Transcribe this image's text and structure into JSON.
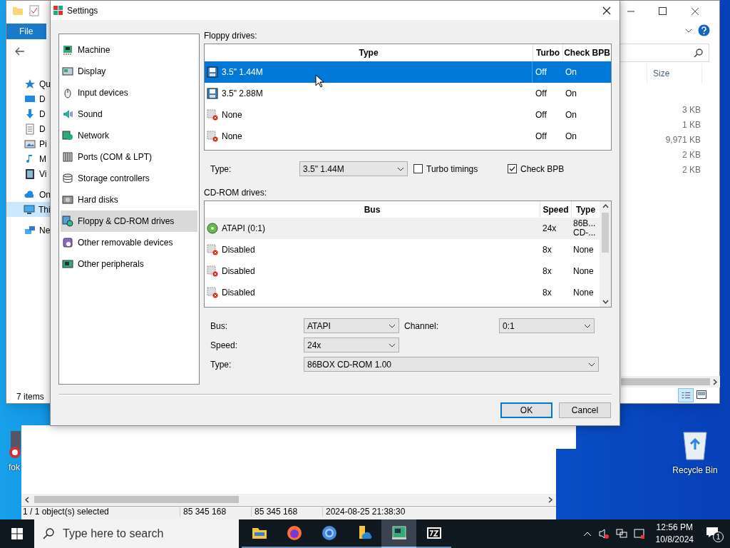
{
  "explorer": {
    "ribbon_tab": "File",
    "nav_items": [
      {
        "label": "Qu",
        "kind": "star",
        "selected": false
      },
      {
        "label": "D",
        "kind": "desktop",
        "selected": false
      },
      {
        "label": "D",
        "kind": "download",
        "selected": false
      },
      {
        "label": "D",
        "kind": "document",
        "selected": false
      },
      {
        "label": "Pi",
        "kind": "picture",
        "selected": false
      },
      {
        "label": "M",
        "kind": "music",
        "selected": false
      },
      {
        "label": "Vi",
        "kind": "video",
        "selected": false
      },
      {
        "label": "On",
        "kind": "cloud",
        "selected": false
      },
      {
        "label": "Thi",
        "kind": "pc",
        "selected": true
      },
      {
        "label": "Ne",
        "kind": "network",
        "selected": false
      }
    ],
    "size_header": "Size",
    "sizes": [
      "3 KB",
      "1 KB",
      "9,971 KB",
      "2 KB",
      "2 KB"
    ],
    "status": "7 items"
  },
  "dialog": {
    "title": "Settings",
    "categories": [
      {
        "label": "Machine",
        "selected": false
      },
      {
        "label": "Display",
        "selected": false
      },
      {
        "label": "Input devices",
        "selected": false
      },
      {
        "label": "Sound",
        "selected": false
      },
      {
        "label": "Network",
        "selected": false
      },
      {
        "label": "Ports (COM & LPT)",
        "selected": false
      },
      {
        "label": "Storage controllers",
        "selected": false
      },
      {
        "label": "Hard disks",
        "selected": false
      },
      {
        "label": "Floppy & CD-ROM drives",
        "selected": true
      },
      {
        "label": "Other removable devices",
        "selected": false
      },
      {
        "label": "Other peripherals",
        "selected": false
      }
    ],
    "floppy_label": "Floppy drives:",
    "floppy_columns": [
      "Type",
      "Turbo",
      "Check BPB"
    ],
    "floppy_rows": [
      {
        "kind": "floppy",
        "type": "3.5\" 1.44M",
        "turbo": "Off",
        "check_bpb": "On",
        "selected": true
      },
      {
        "kind": "floppy",
        "type": "3.5\" 2.88M",
        "turbo": "Off",
        "check_bpb": "On",
        "selected": false
      },
      {
        "kind": "none",
        "type": "None",
        "turbo": "Off",
        "check_bpb": "On",
        "selected": false
      },
      {
        "kind": "none",
        "type": "None",
        "turbo": "Off",
        "check_bpb": "On",
        "selected": false
      }
    ],
    "floppy_type_label": "Type:",
    "floppy_type_value": "3.5\" 1.44M",
    "turbo_timings": {
      "label": "Turbo timings",
      "checked": false
    },
    "check_bpb": {
      "label": "Check BPB",
      "checked": true
    },
    "cdrom_label": "CD-ROM drives:",
    "cdrom_columns": [
      "Bus",
      "Speed",
      "Type"
    ],
    "cdrom_rows": [
      {
        "kind": "cd",
        "bus": "ATAPI (0:1)",
        "speed": "24x",
        "type": [
          "86B...",
          "CD-..."
        ],
        "selected": true
      },
      {
        "kind": "disabled",
        "bus": "Disabled",
        "speed": "8x",
        "type": [
          "None"
        ],
        "selected": false
      },
      {
        "kind": "disabled",
        "bus": "Disabled",
        "speed": "8x",
        "type": [
          "None"
        ],
        "selected": false
      },
      {
        "kind": "disabled",
        "bus": "Disabled",
        "speed": "8x",
        "type": [
          "None"
        ],
        "selected": false
      }
    ],
    "bus_label": "Bus:",
    "bus_value": "ATAPI",
    "channel_label": "Channel:",
    "channel_value": "0:1",
    "speed_label": "Speed:",
    "speed_value": "24x",
    "type_label": "Type:",
    "type_value": "86BOX CD-ROM 1.00",
    "buttons": [
      "OK",
      "Cancel"
    ]
  },
  "back_window": {
    "status": [
      "1 / 1 object(s) selected",
      "85 345 168",
      "85 345 168",
      "2024-08-25 21:38:30"
    ]
  },
  "desktop_icons": [
    {
      "kind": "app",
      "label": "fok"
    },
    {
      "kind": "recycle",
      "label": "Recycle Bin"
    }
  ],
  "taskbar": {
    "search_placeholder": "Type here to search",
    "apps": [
      {
        "kind": "folder",
        "active": false
      },
      {
        "kind": "firefox",
        "active": false
      },
      {
        "kind": "chrome",
        "active": false
      },
      {
        "kind": "onedrive",
        "active": false
      },
      {
        "kind": "emulator",
        "active": true
      },
      {
        "kind": "archive",
        "active": false
      }
    ],
    "time": "12:56 PM",
    "date": "10/8/2024",
    "notifications": "1"
  }
}
